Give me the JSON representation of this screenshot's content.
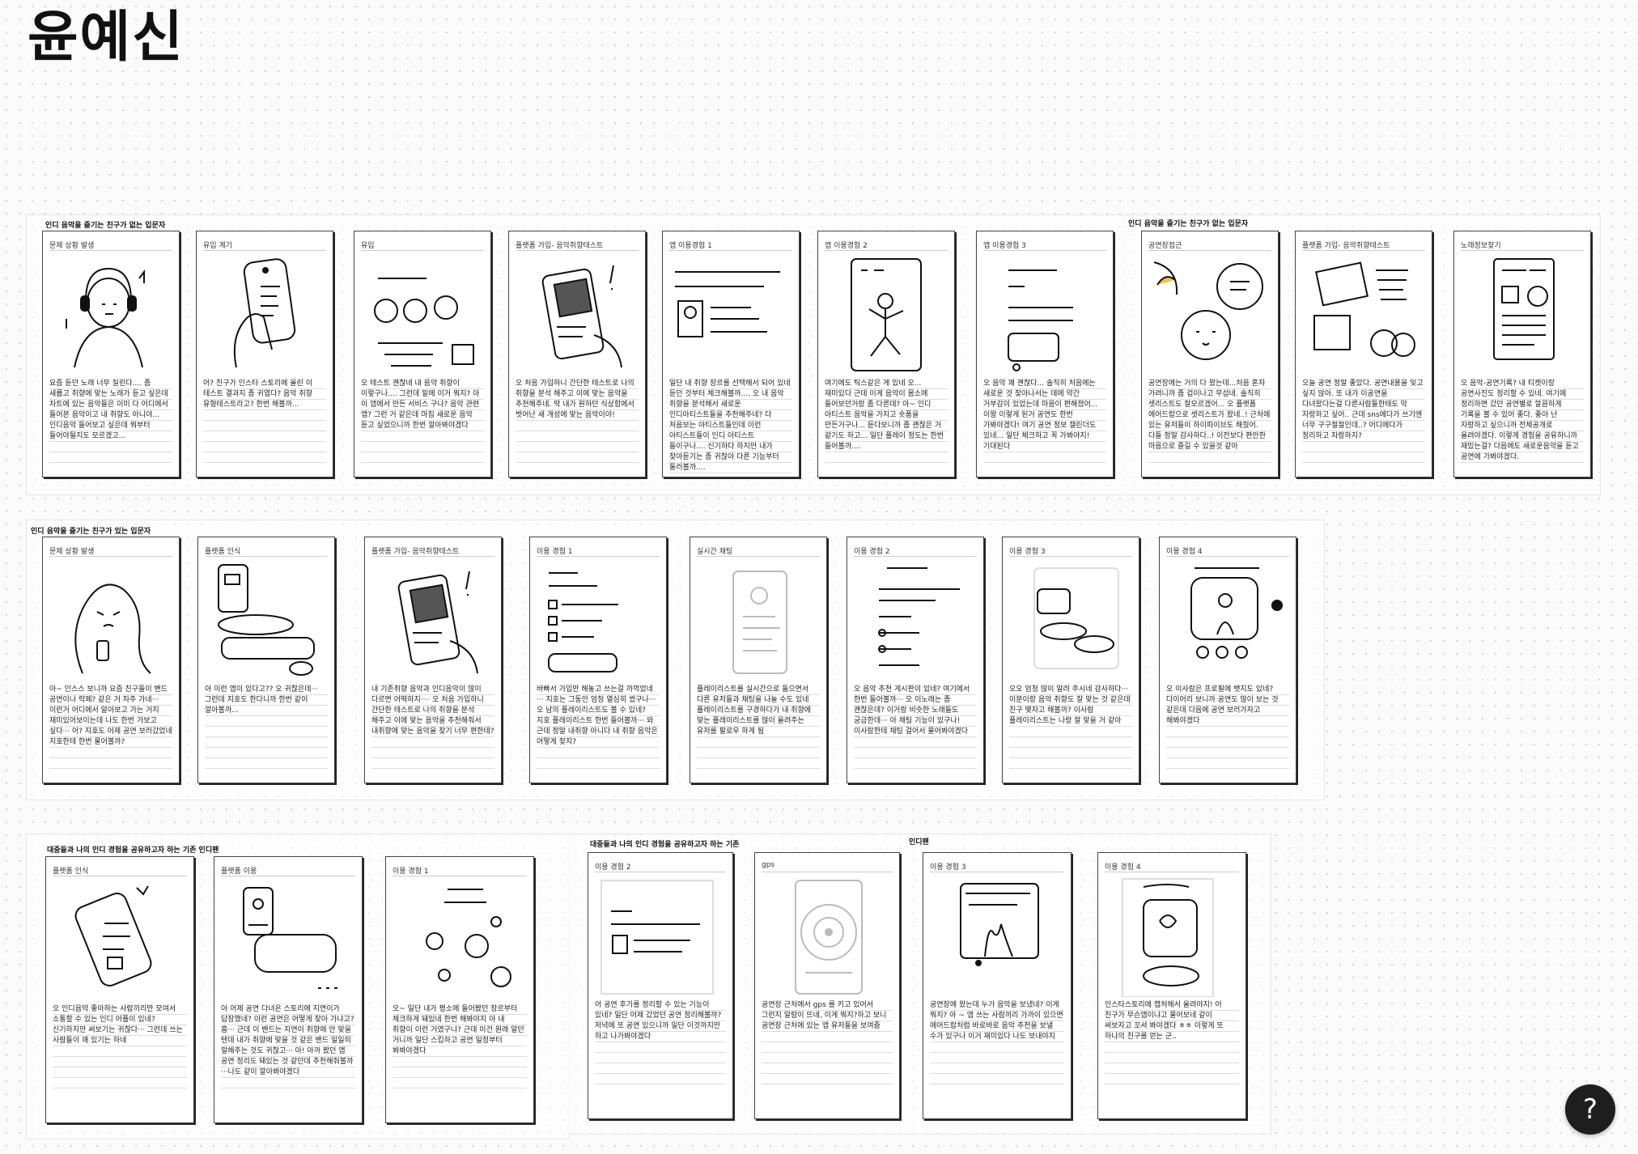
{
  "title": "윤예신",
  "help_label": "?",
  "sections": [
    {
      "label": "인디 음악을 즐기는 친구가 없는 입문자"
    },
    {
      "label": "인디 음악을 즐기는 친구가 없는 입문자"
    },
    {
      "label": "인디 음악을 즐기는 친구가 있는 입문자"
    },
    {
      "label": "대중들과 나의 인디 경험을 공유하고자 하는 기존 인디팬"
    },
    {
      "label": "대중들과 나의 인디 경험을 공유하고자 하는 기존"
    },
    {
      "label": "인디팬"
    }
  ],
  "cards": [
    {
      "title": "문제 상황 발생",
      "text": "요즘 듣던 노래 너무 질린다.... 좀 새롭고 취향에 맞는 노래가 듣고 싶은데 차트에 있는 음악들은 이미 다 어디에서 들어본 음악이고 내 취향도 아니야... 인디음악 들어보고 싶은데 뭐부터 들어야될지도 모르겠고..."
    },
    {
      "title": "유입 계기",
      "text": "어? 친구가 인스타 스토리에 올린 이 테스트 결과지 좀 귀엽다? 음악 취향 유형테스트라고? 한번 해볼까..."
    },
    {
      "title": "유입",
      "text": "오 테스트 괜찮네 내 음악 취향이 이렇구나.... 그런데 밑에 이거 뭐지? 아 이 앱에서 만든 서비스 구나? 음악 관련 앱? 그런 거 같은데 마침 새로운 음악 듣고 싶었으니까 한번 깔아봐야겠다"
    },
    {
      "title": "플랫폼 가입- 음악취향테스트",
      "text": "오 처음 가입하니 간단한 테스트로 나의 취향을 분석 해주고 이에 맞는 음악을 추천해주네. 딱 내가 원하던 식상함에서 벗어난 새 개성에 맞는 음악이야!"
    },
    {
      "title": "앱 이용경험 1",
      "text": "일단 내 취향 장르를 선택해서 되어 있네 듣던 것부터 체크해볼까.... 오 내 음악 취향을 분석해서 새로운 인디아티스트들을 추천해주네? 다 처음보는 아티스트들인데 이런 아티스트들이 인디 아티스트 들이구나.... 신기하다 하지만 내가 찾아듣기는 좀 귀찮아 다른 기능부터 둘러볼까...."
    },
    {
      "title": "앱 이용경험 2",
      "text": "여기에도 틱스같은 게 있네 오... 재미있다 근데 이게 음악이 몸소에 들어보던거랑 좀 다른데? 아~ 인디 아티스트 음악을 가지고 숏폼을 만든거구나... 듣다보니까 좀 괜찮은 거 같기도 하고... 일단 플레이 정도는 한번 들어볼까...."
    },
    {
      "title": "앱 이용경험 3",
      "text": "오 음악 꽤 괜찮다... 솔직히 처음에는 새로운 것 찾아나서는 데에 약간 거부감이 있었는데 마음이 편해졌어... 이왕 이렇게 된거 공연도 한번 가봐야겠다! 여기 공연 정보 캘린더도 있네... 일단 체크하고 꼭 가봐야지! 기대된다"
    },
    {
      "title": "공연장접근",
      "text": "공연장에는 거의 다 왔는데...처음 혼자 가려니까 좀 겁이나고 무섭네. 솔직히 셋리스트도 잘모르겠어... 오 플랫폼 에어드랍으로 셋리스트가 왔네..! 근처에 있는 유저들이 하이파이브도 해줬어. 다들 정말 감사하다..! 이전보다 편안한 마음으로 즐길 수 있을것 같아"
    },
    {
      "title": "플랫폼 가입- 음악취향테스트",
      "text": "오늘 공연 정말 좋았다. 공연내용을 잊고 싶지 않아. 또 내가 이공연을 다녀왔다는걸 다른사람들한테도 막 자랑하고 싶어.. 근데 sns에다가 쓰기엔 너무 구구절절인데..? 어디에다가 정리하고 자랑하지?"
    },
    {
      "title": "노래정보찾기",
      "text": "오 음악-공연기록? 내 티켓이랑 공연사진도 정리할 수 있네. 여기에 정리하면 갔던 공연별로 깔끔하게 기록을 볼 수 있어 좋다. 좋아 난 자랑하고 싶으니까 전체공개로 올려야겠다. 이렇게 경험을 공유하니까 재밌는걸? 다음에도 새로운음악을 듣고 공연에 가봐야겠다."
    },
    {
      "title": "문제 상황 발생",
      "text": "아~ 인스스 보니까 요즘 친구들이 밴드 공연이나 락페? 같은 거 자주 가네··· 이런거 어디에서 알아보고 가는 거지 재미있어보이는데 나도 한번 가보고 싶다··· 어? 지호도 어제 공연 보러갔었네 지호한테 한번 물어볼까?"
    },
    {
      "title": "플랫폼 인식",
      "text": "아 이런 앱이 있다고?? 오 귀찮은데··· 그런데 지호도 한다니까 한번 같이 깔아볼까..."
    },
    {
      "title": "플랫폼 가입- 음악취향테스트",
      "text": "내 기존취향 음악과 인디음악이 많이 다르면 어떡하지···· 오 처음 가입하니 간단한 테스트로 나의 취향을 분석 해주고 이에 맞는 음악을 추천해줘서 내취향에 맞는 음악을 찾기 너무 편한데?"
    },
    {
      "title": "이용 경험 1",
      "text": "바빠서 가입만 해놓고 쓰는걸 까먹었네··· 지호는 그동안 엄청 열심히 썼구나···오 남의 플레이리스트도 볼 수 있네? 지호 플레이리스트 한번 들어볼까··· 와 근데 정말 내취향 아니다 내 취향 음악은 어떻게 찾지?"
    },
    {
      "title": "실시간 채팅",
      "text": "플레이리스트를 실시간으로 들으면서 다른 유저들과 채팅을 나눌 수도 있네 플레이리스트를 구경하다가 내 취향에 맞는 플레이리스트를 많이 올려주는 유저를 팔로우 하게 됨"
    },
    {
      "title": "이용 경험 2",
      "text": "오 음악 추천 게시판이 있네? 여기에서 한번 들어볼까··· 오 이노래는 좀 괜찮은데? 이거랑 비슷한 노래들도 궁금한데··· 아 채팅 기능이 있구나! 이사람한테 채팅 걸어서 물어봐야겠다"
    },
    {
      "title": "이용 경험 3",
      "text": "오오 엄청 많이 알려 주시네 감사하다··· 이분이랑 음악 취향도 잘 맞는 것 같은데 친구 맺자고 해볼까? 이사람 플레이리스트는 나랑 잘 맞을 거 같아"
    },
    {
      "title": "이용 경험 4",
      "text": "오 이사람은 프로필에 뱃지도 있네? 다이어리 보니까 공연도 많이 보는 것 같은데 다음에 공연 보러가자고 해봐야겠다"
    },
    {
      "title": "플랫폼 인식",
      "text": "오 인디음악 좋아하는 사람끼리만 모여서 소통할 수 있는 인디 어플이 있네? 신기하지만 써보기는 귀찮다··· 그런데 쓰는 사람들이 꽤 있기는 하네"
    },
    {
      "title": "플랫폼 이용",
      "text": "아 어제 공연 다녀온 스토리에 지연이가 답장했네? 이런 공연은 어떻게 찾아 가냐고? 흠··· 근데 이 밴드는 지연이 취향에 안 맞을 텐데 내가 취향에 맞을 것 같은 밴드 일일히 말해주는 것도 귀찮고··· 아! 아까 봤던 앱 공연 정리도 돼있는 것 같던데 추천해줘볼까···나도 같이 깔아봐야겠다"
    },
    {
      "title": "이용 경험 1",
      "text": "오~ 일단 내가 평소에 들어봤던 장르부터 체크하게 돼있네 한번 해봐야지 아 내 취향이 이런 거였구나? 근데 이건 원래 알던 거니까 일단 스킵하고 공연 일정부터 봐봐야겠다"
    },
    {
      "title": "이용 경험 2",
      "text": "어 공연 후기를 정리할 수 있는 기능이 있네? 일단 어제 갔었던 공연 정리해볼까? 저녁에 또 공연 있으니까 일단 이것까지만 하고 나가봐야겠다"
    },
    {
      "title": "gps",
      "text": "공연장 근처에서 gps 를 키고 있어서 그런지 알람이 뜨네, 이게 뭐지?하고 보니 공연장 근처에 있는 앱 유저들을 보여줌"
    },
    {
      "title": "이용 경험 3",
      "text": "공연장에 왔는데 누가 음악을 보냈네? 이게 뭐지? 아 ~ 앱 쓰는 사람끼리 가까이 있으면 에어드랍처럼 바로바로 음악 추천을 보낼 수가 있구나 이거 재미있다 나도 보내야지"
    },
    {
      "title": "이용 경험 4",
      "text": "인스타스토리에 캡처해서 올려야지! 어 친구가 무슨앱이냐고 물어보네 같이 써보자고 꼬셔 봐야겠다 ㅎㅎ 이렇게 또 하나의 친구를 얻는 군.."
    }
  ]
}
